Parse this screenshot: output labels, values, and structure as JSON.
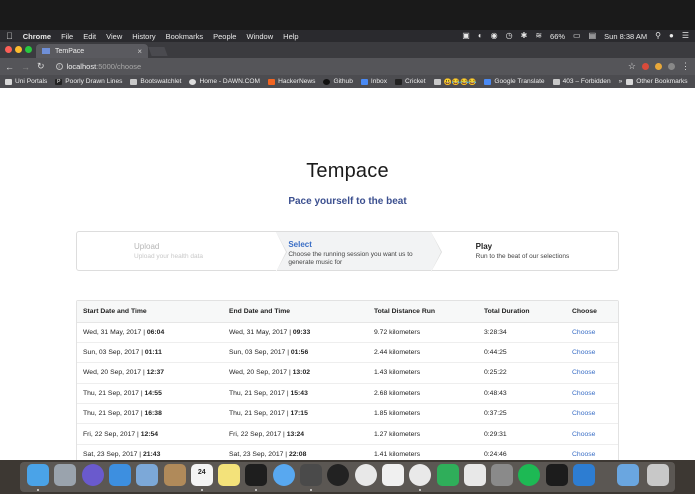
{
  "menubar": {
    "apple": "",
    "app_name": "Chrome",
    "items": [
      "File",
      "Edit",
      "View",
      "History",
      "Bookmarks",
      "People",
      "Window",
      "Help"
    ],
    "battery": "66%",
    "clock": "Sun 8:38 AM"
  },
  "browser": {
    "tab_title": "TemPace",
    "url_host": "localhost",
    "url_path": ":5000/choose",
    "bookmarks": [
      {
        "label": "Uni Portals",
        "icon": "folder-icon"
      },
      {
        "label": "Poorly Drawn Lines",
        "icon": "p-logo-icon"
      },
      {
        "label": "Bootswatchlet",
        "icon": "page-icon"
      },
      {
        "label": "Home - DAWN.COM",
        "icon": "dawn-icon"
      },
      {
        "label": "HackerNews",
        "icon": "ycombinator-icon"
      },
      {
        "label": "Github",
        "icon": "github-icon"
      },
      {
        "label": "Inbox",
        "icon": "inbox-icon"
      },
      {
        "label": "Cricket",
        "icon": "cricket-icon"
      },
      {
        "label": "😃😂😂😂",
        "icon": "page-icon"
      },
      {
        "label": "Google Translate",
        "icon": "google-translate-icon"
      },
      {
        "label": "403 – Forbidden",
        "icon": "page-icon"
      }
    ],
    "other_bookmarks": "Other Bookmarks"
  },
  "page": {
    "title": "Tempace",
    "subtitle": "Pace yourself to the beat",
    "steps": [
      {
        "title": "Upload",
        "desc": "Upload your health data",
        "state": "done"
      },
      {
        "title": "Select",
        "desc": "Choose the running session you want us to generate music for",
        "state": "active"
      },
      {
        "title": "Play",
        "desc": "Run to the beat of our selections",
        "state": "upcoming"
      }
    ],
    "table": {
      "headers": [
        "Start Date and Time",
        "End Date and Time",
        "Total Distance Run",
        "Total Duration",
        "Choose"
      ],
      "rows": [
        {
          "start_date": "Wed, 31 May, 2017 | ",
          "start_time": "06:04",
          "end_date": "Wed, 31 May, 2017 | ",
          "end_time": "09:33",
          "distance": "9.72 kilometers",
          "duration": "3:28:34",
          "action": "Choose"
        },
        {
          "start_date": "Sun, 03 Sep, 2017 | ",
          "start_time": "01:11",
          "end_date": "Sun, 03 Sep, 2017 | ",
          "end_time": "01:56",
          "distance": "2.44 kilometers",
          "duration": "0:44:25",
          "action": "Choose"
        },
        {
          "start_date": "Wed, 20 Sep, 2017 | ",
          "start_time": "12:37",
          "end_date": "Wed, 20 Sep, 2017 | ",
          "end_time": "13:02",
          "distance": "1.43 kilometers",
          "duration": "0:25:22",
          "action": "Choose"
        },
        {
          "start_date": "Thu, 21 Sep, 2017 | ",
          "start_time": "14:55",
          "end_date": "Thu, 21 Sep, 2017 | ",
          "end_time": "15:43",
          "distance": "2.68 kilometers",
          "duration": "0:48:43",
          "action": "Choose"
        },
        {
          "start_date": "Thu, 21 Sep, 2017 | ",
          "start_time": "16:38",
          "end_date": "Thu, 21 Sep, 2017 | ",
          "end_time": "17:15",
          "distance": "1.85 kilometers",
          "duration": "0:37:25",
          "action": "Choose"
        },
        {
          "start_date": "Fri, 22 Sep, 2017 | ",
          "start_time": "12:54",
          "end_date": "Fri, 22 Sep, 2017 | ",
          "end_time": "13:24",
          "distance": "1.27 kilometers",
          "duration": "0:29:31",
          "action": "Choose"
        },
        {
          "start_date": "Sat, 23 Sep, 2017 | ",
          "start_time": "21:43",
          "end_date": "Sat, 23 Sep, 2017 | ",
          "end_time": "22:08",
          "distance": "1.41 kilometers",
          "duration": "0:24:46",
          "action": "Choose"
        }
      ]
    }
  },
  "dock": {
    "calendar_day": "24",
    "apps": [
      "finder-icon",
      "launchpad-icon",
      "siri-icon",
      "safari-icon",
      "preview-icon",
      "contacts-icon",
      "calendar-icon",
      "notes-icon",
      "terminal-icon",
      "messages-icon",
      "sublime-text-icon",
      "github-desktop-icon",
      "photos-icon",
      "textedit-icon",
      "chrome-icon",
      "numbers-icon",
      "itunes-icon",
      "system-preferences-icon",
      "spotify-icon",
      "pycharm-icon",
      "xcode-icon",
      "downloads-folder-icon",
      "trash-icon"
    ]
  },
  "colors": {
    "accent": "#3b6fc6",
    "subtitle": "#3b4f8f",
    "menubar": "#2a2a2e",
    "dock": "#3d3833"
  }
}
